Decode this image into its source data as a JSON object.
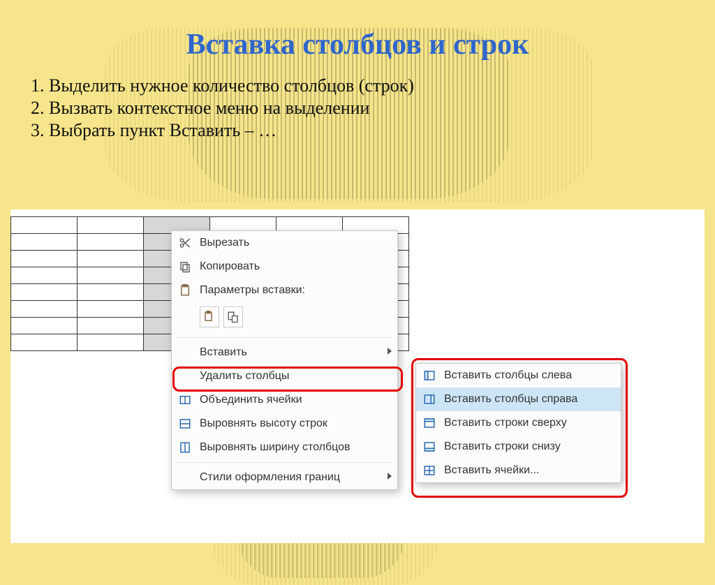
{
  "slide": {
    "title": "Вставка столбцов и строк",
    "steps": [
      "Выделить нужное количество столбцов (строк)",
      "Вызвать контекстное меню на выделении",
      "Выбрать пункт Вставить – …"
    ]
  },
  "context_menu": {
    "cut": "Вырезать",
    "copy": "Копировать",
    "paste_options_header": "Параметры вставки:",
    "insert": "Вставить",
    "delete_columns": "Удалить столбцы",
    "merge_cells": "Объединить ячейки",
    "equal_row_height": "Выровнять высоту строк",
    "equal_col_width": "Выровнять ширину столбцов",
    "border_styles": "Стили оформления границ"
  },
  "submenu": {
    "cols_left": "Вставить столбцы слева",
    "cols_right": "Вставить столбцы справа",
    "rows_above": "Вставить строки сверху",
    "rows_below": "Вставить строки снизу",
    "cells": "Вставить ячейки..."
  },
  "table": {
    "rows": 8,
    "cols": 6,
    "selected_col_index": 2
  }
}
